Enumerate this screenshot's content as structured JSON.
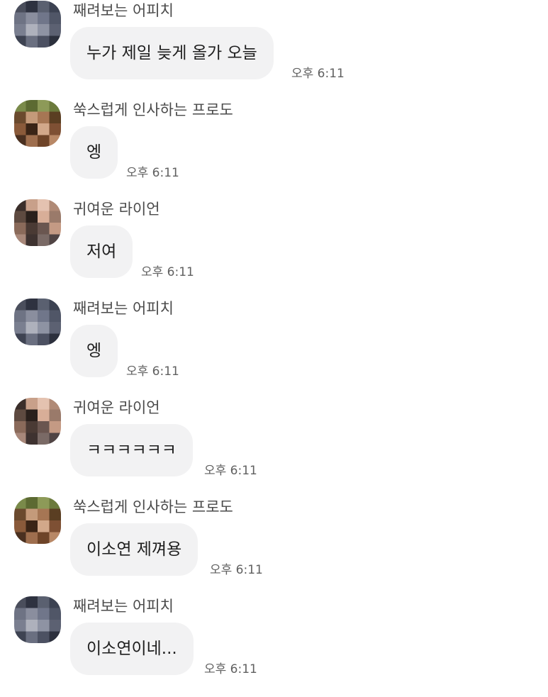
{
  "messages": [
    {
      "sender": "째려보는 어피치",
      "text": "누가 제일 늦게 올가 오늘",
      "time": "오후 6:11",
      "avatar_icon": "peach-avatar-icon"
    },
    {
      "sender": "쑥스럽게 인사하는 프로도",
      "text": "엥",
      "time": "오후 6:11",
      "avatar_icon": "frodo-avatar-icon"
    },
    {
      "sender": "귀여운 라이언",
      "text": "저여",
      "time": "오후 6:11",
      "avatar_icon": "ryan-avatar-icon"
    },
    {
      "sender": "째려보는 어피치",
      "text": "엥",
      "time": "오후 6:11",
      "avatar_icon": "peach-avatar-icon"
    },
    {
      "sender": "귀여운 라이언",
      "text": "ㅋㅋㅋㅋㅋㅋ",
      "time": "오후 6:11",
      "avatar_icon": "ryan-avatar-icon"
    },
    {
      "sender": "쑥스럽게 인사하는 프로도",
      "text": "이소연 제껴용",
      "time": "오후 6:11",
      "avatar_icon": "frodo-avatar-icon"
    },
    {
      "sender": "째려보는 어피치",
      "text": "이소연이네...",
      "time": "오후 6:11",
      "avatar_icon": "peach-avatar-icon"
    }
  ],
  "colors": {
    "background": "#ffffff",
    "bubble": "#f2f2f3",
    "text": "#1e1e1e",
    "sender": "#4a4a4a",
    "time": "#606060"
  }
}
